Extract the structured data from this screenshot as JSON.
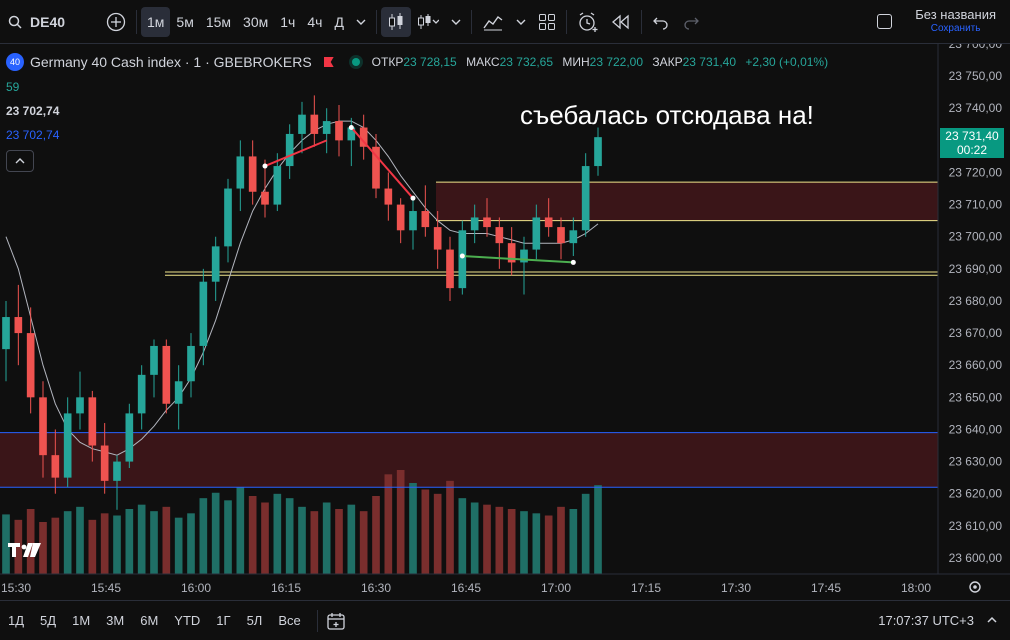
{
  "toolbar": {
    "symbol": "DE40",
    "intervals": [
      "1м",
      "5м",
      "15м",
      "30м",
      "1ч",
      "4ч",
      "Д"
    ],
    "active_interval": "1м",
    "layout_title": "Без названия",
    "layout_status": "Сохранить"
  },
  "legend": {
    "badge": "40",
    "title": "Germany 40 Cash index · 1 · GBEBROKERS",
    "open_label": "ОТКР",
    "open": "23 728,15",
    "high_label": "МАКС",
    "high": "23 732,65",
    "low_label": "МИН",
    "low": "23 722,00",
    "close_label": "ЗАКР",
    "close": "23 731,40",
    "change": "+2,30 (+0,01%)",
    "ind_period": "59",
    "ind_value1": "23 702,74",
    "ind_value2": "23 702,74"
  },
  "annotation": "съебалась отсюдава на!",
  "last_price": {
    "price": "23 731,40",
    "countdown": "00:22"
  },
  "price_axis": [
    "23 700,00",
    "23 750,00",
    "23 740,00",
    "23 730,00",
    "23 720,00",
    "23 710,00",
    "23 700,00",
    "23 690,00",
    "23 680,00",
    "23 670,00",
    "23 660,00",
    "23 650,00",
    "23 640,00",
    "23 630,00",
    "23 620,00",
    "23 610,00",
    "23 600,00"
  ],
  "time_axis": [
    "15:30",
    "15:45",
    "16:00",
    "16:15",
    "16:30",
    "16:45",
    "17:00",
    "17:15",
    "17:30",
    "17:45",
    "18:00"
  ],
  "ranges": [
    "1Д",
    "5Д",
    "1М",
    "3М",
    "6М",
    "YTD",
    "1Г",
    "5Л",
    "Все"
  ],
  "clock": "17:07:37 UTC+3",
  "colors": {
    "up": "#26a69a",
    "down": "#ef5350",
    "zone": "#3a1518",
    "yellow": "#f0e68c",
    "blue": "#2962ff",
    "green_line": "#4caf50",
    "red_line": "#f23645"
  },
  "chart_data": {
    "type": "candlestick",
    "ylim": [
      23595,
      23760
    ],
    "candles": [
      [
        23665,
        23680,
        23655,
        23675
      ],
      [
        23675,
        23685,
        23660,
        23670
      ],
      [
        23670,
        23678,
        23645,
        23650
      ],
      [
        23650,
        23655,
        23625,
        23632
      ],
      [
        23632,
        23640,
        23620,
        23625
      ],
      [
        23625,
        23650,
        23622,
        23645
      ],
      [
        23645,
        23658,
        23640,
        23650
      ],
      [
        23650,
        23652,
        23630,
        23635
      ],
      [
        23635,
        23642,
        23620,
        23624
      ],
      [
        23624,
        23632,
        23615,
        23630
      ],
      [
        23630,
        23648,
        23628,
        23645
      ],
      [
        23645,
        23660,
        23640,
        23657
      ],
      [
        23657,
        23668,
        23650,
        23666
      ],
      [
        23666,
        23668,
        23645,
        23648
      ],
      [
        23648,
        23660,
        23640,
        23655
      ],
      [
        23655,
        23670,
        23650,
        23666
      ],
      [
        23666,
        23690,
        23660,
        23686
      ],
      [
        23686,
        23700,
        23680,
        23697
      ],
      [
        23697,
        23718,
        23692,
        23715
      ],
      [
        23715,
        23730,
        23708,
        23725
      ],
      [
        23725,
        23730,
        23710,
        23714
      ],
      [
        23714,
        23724,
        23706,
        23710
      ],
      [
        23710,
        23726,
        23708,
        23722
      ],
      [
        23722,
        23735,
        23718,
        23732
      ],
      [
        23732,
        23742,
        23726,
        23738
      ],
      [
        23738,
        23744,
        23728,
        23732
      ],
      [
        23732,
        23740,
        23726,
        23736
      ],
      [
        23736,
        23741,
        23725,
        23730
      ],
      [
        23730,
        23737,
        23722,
        23734
      ],
      [
        23734,
        23738,
        23724,
        23728
      ],
      [
        23728,
        23732,
        23712,
        23715
      ],
      [
        23715,
        23720,
        23705,
        23710
      ],
      [
        23710,
        23712,
        23698,
        23702
      ],
      [
        23702,
        23712,
        23696,
        23708
      ],
      [
        23708,
        23716,
        23700,
        23703
      ],
      [
        23703,
        23708,
        23690,
        23696
      ],
      [
        23696,
        23700,
        23680,
        23684
      ],
      [
        23684,
        23705,
        23682,
        23702
      ],
      [
        23702,
        23710,
        23698,
        23706
      ],
      [
        23706,
        23712,
        23700,
        23703
      ],
      [
        23703,
        23706,
        23690,
        23698
      ],
      [
        23698,
        23703,
        23688,
        23692
      ],
      [
        23692,
        23700,
        23682,
        23696
      ],
      [
        23696,
        23710,
        23693,
        23706
      ],
      [
        23706,
        23712,
        23700,
        23703
      ],
      [
        23703,
        23706,
        23693,
        23698
      ],
      [
        23698,
        23706,
        23694,
        23702
      ],
      [
        23702,
        23726,
        23700,
        23722
      ],
      [
        23722,
        23734,
        23719,
        23731
      ]
    ],
    "volumes": [
      55,
      50,
      60,
      48,
      52,
      58,
      62,
      50,
      56,
      54,
      60,
      64,
      58,
      62,
      52,
      56,
      70,
      75,
      68,
      80,
      72,
      66,
      74,
      70,
      62,
      58,
      66,
      60,
      64,
      58,
      72,
      92,
      96,
      84,
      78,
      74,
      86,
      70,
      66,
      64,
      62,
      60,
      58,
      56,
      54,
      62,
      60,
      74,
      82
    ],
    "sma": [
      23700,
      23690,
      23675,
      23660,
      23648,
      23640,
      23636,
      23634,
      23633,
      23632,
      23634,
      23637,
      23641,
      23646,
      23650,
      23656,
      23664,
      23674,
      23686,
      23698,
      23708,
      23715,
      23721,
      23726,
      23730,
      23733,
      23735,
      23736,
      23736,
      23734,
      23730,
      23725,
      23719,
      23714,
      23709,
      23705,
      23702,
      23701,
      23701,
      23701,
      23700,
      23699,
      23698,
      23698,
      23698,
      23698,
      23699,
      23701,
      23704
    ],
    "levels": {
      "yellow": [
        23717,
        23705,
        23689,
        23688
      ],
      "blue": [
        23639,
        23622
      ]
    },
    "zones": [
      [
        23705,
        23717
      ],
      [
        23622,
        23639
      ]
    ]
  }
}
